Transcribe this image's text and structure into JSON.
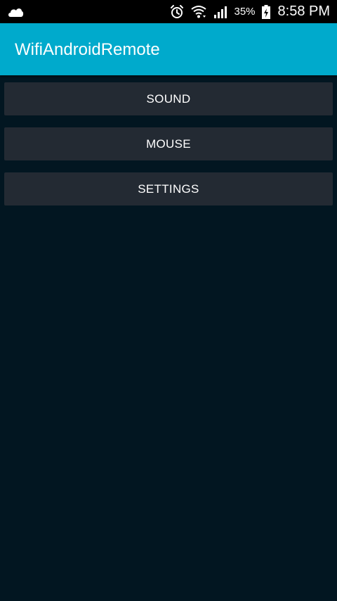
{
  "status_bar": {
    "notification_icon": "cloud-icon",
    "alarm_icon": "alarm-clock-icon",
    "wifi_icon": "wifi-icon",
    "signal_icon": "cell-signal-icon",
    "battery_percent": "35%",
    "battery_icon": "battery-charging-icon",
    "time": "8:58 PM"
  },
  "app_bar": {
    "title": "WifiAndroidRemote",
    "color": "#00aacc"
  },
  "main": {
    "buttons": [
      {
        "label": "SOUND"
      },
      {
        "label": "MOUSE"
      },
      {
        "label": "SETTINGS"
      }
    ],
    "background_color": "#021621",
    "button_color": "#232a33"
  }
}
